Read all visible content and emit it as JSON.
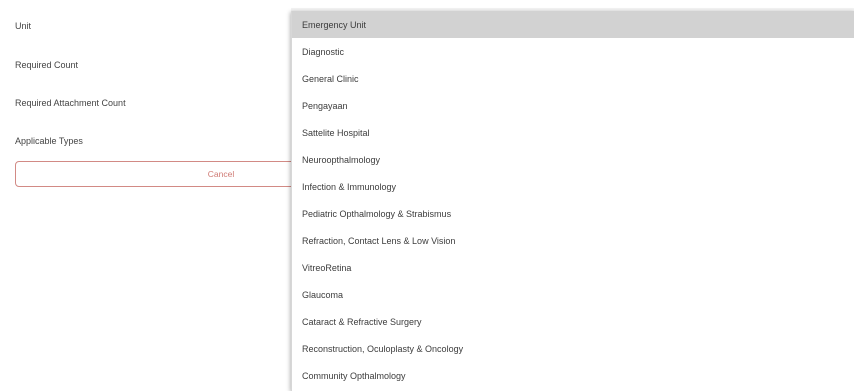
{
  "form": {
    "labels": {
      "unit": "Unit",
      "required_count": "Required Count",
      "required_attachment_count": "Required Attachment Count",
      "applicable_types": "Applicable Types"
    },
    "cancel_label": "Cancel"
  },
  "unit_dropdown": {
    "selected": "Emergency Unit",
    "options": [
      "Emergency Unit",
      "Diagnostic",
      "General Clinic",
      "Pengayaan",
      "Sattelite Hospital",
      "Neuroopthalmology",
      "Infection & Immunology",
      "Pediatric Opthalmology & Strabismus",
      "Refraction, Contact Lens & Low Vision",
      "VitreoRetina",
      "Glaucoma",
      "Cataract & Refractive Surgery",
      "Reconstruction, Oculoplasty & Oncology",
      "Community Opthalmology"
    ]
  },
  "colors": {
    "selected_option_bg": "#d2d2d2",
    "cancel_border": "#d28a85",
    "cancel_text": "#d07b75"
  }
}
